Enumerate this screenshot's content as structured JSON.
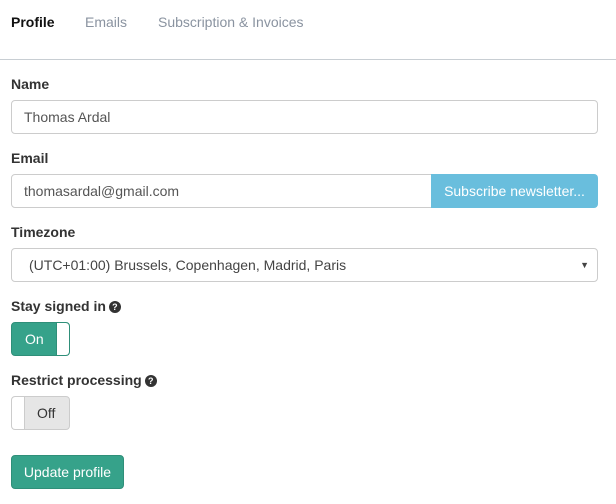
{
  "tabs": [
    {
      "label": "Profile",
      "active": true
    },
    {
      "label": "Emails",
      "active": false
    },
    {
      "label": "Subscription & Invoices",
      "active": false
    }
  ],
  "form": {
    "name": {
      "label": "Name",
      "value": "Thomas Ardal"
    },
    "email": {
      "label": "Email",
      "value": "thomasardal@gmail.com",
      "subscribe_label": "Subscribe newsletter..."
    },
    "timezone": {
      "label": "Timezone",
      "selected": "(UTC+01:00) Brussels, Copenhagen, Madrid, Paris",
      "caret": "▼"
    },
    "stay_signed_in": {
      "label": "Stay signed in",
      "help_icon": "?",
      "state": "On"
    },
    "restrict_processing": {
      "label": "Restrict processing",
      "help_icon": "?",
      "state": "Off"
    },
    "submit_label": "Update profile"
  },
  "colors": {
    "primary": "#36a28a",
    "info": "#69bedd"
  }
}
